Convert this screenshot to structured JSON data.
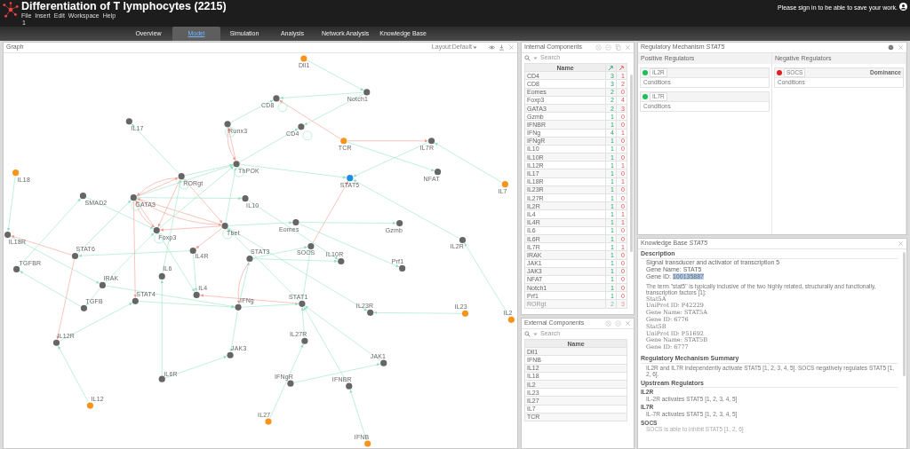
{
  "app": {
    "title": "Differentiation of T lymphocytes (2215)",
    "menu": [
      "File",
      "Insert",
      "Edit",
      "Workspace",
      "Help"
    ],
    "version": "1",
    "sign_in": "Please sign in to be able to save your work."
  },
  "tabs": [
    {
      "label": "Overview",
      "selected": false
    },
    {
      "label": "Model",
      "selected": true
    },
    {
      "label": "Simulation",
      "selected": false
    },
    {
      "label": "Analysis",
      "selected": false
    },
    {
      "label": "Network Analysis",
      "selected": false
    },
    {
      "label": "Knowledge Base",
      "selected": false
    }
  ],
  "graph": {
    "title": "Graph",
    "layout": "Layout:Default",
    "nodes": [
      {
        "label": "Dll1",
        "color": "#f7941d"
      },
      {
        "label": "Notch1",
        "color": "#666666"
      },
      {
        "label": "CD8",
        "color": "#666666"
      },
      {
        "label": "IL17",
        "color": "#666666"
      },
      {
        "label": "Runx3",
        "color": "#666666"
      },
      {
        "label": "CD4",
        "color": "#666666"
      },
      {
        "label": "TCR",
        "color": "#f7941d"
      },
      {
        "label": "IL7R",
        "color": "#666666"
      },
      {
        "label": "ThPOK",
        "color": "#666666"
      },
      {
        "label": "IL18",
        "color": "#f7941d"
      },
      {
        "label": "NFAT",
        "color": "#666666"
      },
      {
        "label": "RORgt",
        "color": "#666666"
      },
      {
        "label": "STAT5",
        "color": "#1a8fe3"
      },
      {
        "label": "IL7",
        "color": "#f7941d"
      },
      {
        "label": "SMAD2",
        "color": "#666666"
      },
      {
        "label": "GATA3",
        "color": "#666666"
      },
      {
        "label": "IL10",
        "color": "#666666"
      },
      {
        "label": "Eomes",
        "color": "#666666"
      },
      {
        "label": "Gzmb",
        "color": "#666666"
      },
      {
        "label": "Tbet",
        "color": "#666666"
      },
      {
        "label": "Foxp3",
        "color": "#666666"
      },
      {
        "label": "IL18R",
        "color": "#666666"
      },
      {
        "label": "IL2R",
        "color": "#666666"
      },
      {
        "label": "SOCS",
        "color": "#666666"
      },
      {
        "label": "STAT6",
        "color": "#666666"
      },
      {
        "label": "IL4R",
        "color": "#666666"
      },
      {
        "label": "STAT3",
        "color": "#666666"
      },
      {
        "label": "IL10R",
        "color": "#666666"
      },
      {
        "label": "Prf1",
        "color": "#666666"
      },
      {
        "label": "TGFBR",
        "color": "#666666"
      },
      {
        "label": "IL6",
        "color": "#666666"
      },
      {
        "label": "IRAK",
        "color": "#666666"
      },
      {
        "label": "IL4",
        "color": "#666666"
      },
      {
        "label": "STAT4",
        "color": "#666666"
      },
      {
        "label": "STAT1",
        "color": "#666666"
      },
      {
        "label": "IFNg",
        "color": "#666666"
      },
      {
        "label": "TGFB",
        "color": "#666666"
      },
      {
        "label": "IL23R",
        "color": "#666666"
      },
      {
        "label": "IL23",
        "color": "#f7941d"
      },
      {
        "label": "IL2",
        "color": "#f7941d"
      },
      {
        "label": "IL27R",
        "color": "#666666"
      },
      {
        "label": "IL12R",
        "color": "#666666"
      },
      {
        "label": "JAK3",
        "color": "#666666"
      },
      {
        "label": "JAK1",
        "color": "#666666"
      },
      {
        "label": "IL6R",
        "color": "#666666"
      },
      {
        "label": "IFNgR",
        "color": "#666666"
      },
      {
        "label": "IFNBR",
        "color": "#666666"
      },
      {
        "label": "IL12",
        "color": "#f7941d"
      },
      {
        "label": "IL27",
        "color": "#f7941d"
      },
      {
        "label": "IFNB",
        "color": "#f7941d"
      }
    ]
  },
  "internal_components": {
    "title": "Internal Components",
    "search": {
      "placeholder": "Search"
    },
    "columns": [
      "Name"
    ],
    "rows": [
      {
        "name": "CD4",
        "positive": "3",
        "negative": "1"
      },
      {
        "name": "CD8",
        "positive": "3",
        "negative": "2"
      },
      {
        "name": "Eomes",
        "positive": "2",
        "negative": "0"
      },
      {
        "name": "Foxp3",
        "positive": "2",
        "negative": "4"
      },
      {
        "name": "GATA3",
        "positive": "2",
        "negative": "3"
      },
      {
        "name": "Gzmb",
        "positive": "1",
        "negative": "0"
      },
      {
        "name": "IFNBR",
        "positive": "1",
        "negative": "0"
      },
      {
        "name": "IFNg",
        "positive": "4",
        "negative": "1"
      },
      {
        "name": "IFNgR",
        "positive": "1",
        "negative": "0"
      },
      {
        "name": "IL10",
        "positive": "1",
        "negative": "0"
      },
      {
        "name": "IL10R",
        "positive": "1",
        "negative": "0"
      },
      {
        "name": "IL12R",
        "positive": "1",
        "negative": "1"
      },
      {
        "name": "IL17",
        "positive": "1",
        "negative": "0"
      },
      {
        "name": "IL18R",
        "positive": "1",
        "negative": "1"
      },
      {
        "name": "IL23R",
        "positive": "1",
        "negative": "0"
      },
      {
        "name": "IL27R",
        "positive": "1",
        "negative": "0"
      },
      {
        "name": "IL2R",
        "positive": "1",
        "negative": "0"
      },
      {
        "name": "IL4",
        "positive": "1",
        "negative": "1"
      },
      {
        "name": "IL4R",
        "positive": "1",
        "negative": "1"
      },
      {
        "name": "IL6",
        "positive": "1",
        "negative": "0"
      },
      {
        "name": "IL6R",
        "positive": "1",
        "negative": "0"
      },
      {
        "name": "IL7R",
        "positive": "1",
        "negative": "1"
      },
      {
        "name": "IRAK",
        "positive": "1",
        "negative": "0"
      },
      {
        "name": "JAK1",
        "positive": "1",
        "negative": "0"
      },
      {
        "name": "JAK3",
        "positive": "1",
        "negative": "0"
      },
      {
        "name": "NFAT",
        "positive": "1",
        "negative": "0"
      },
      {
        "name": "Notch1",
        "positive": "1",
        "negative": "0"
      },
      {
        "name": "Prf1",
        "positive": "1",
        "negative": "0"
      },
      {
        "name": "RORgt",
        "positive": "2",
        "negative": "3"
      }
    ]
  },
  "external_components": {
    "title": "External Components",
    "search": {
      "placeholder": "Search"
    },
    "columns": [
      "Name"
    ],
    "rows": [
      "Dll1",
      "IFNB",
      "IL12",
      "IL18",
      "IL2",
      "IL23",
      "IL27",
      "IL7",
      "TCR"
    ]
  },
  "regulatory_mechanism": {
    "title": "Regulatory Mechanism *STAT5*",
    "columns": [
      {
        "title": "Positive Regulators",
        "regulators": [
          {
            "name": "IL2R",
            "color": "#1cbf5a",
            "conditions": "Conditions"
          },
          {
            "name": "IL7R",
            "color": "#1cbf5a",
            "conditions": "Conditions"
          }
        ]
      },
      {
        "title": "Negative Regulators",
        "dominance": "Dominance",
        "regulators": [
          {
            "name": "SOCS",
            "color": "#e02020",
            "conditions": "Conditions"
          }
        ]
      }
    ]
  },
  "knowledge_base": {
    "title": "Knowledge Base *STAT5*",
    "description": {
      "heading": "Description",
      "lines": [
        "Signal transducer and activator of transcription 5",
        "Gene Name: STAT5"
      ],
      "gene_id": {
        "label": "Gene ID:",
        "value": "100135887",
        "highlighted": true
      },
      "paragraph": "The term \"stat5\" is typically inclusive of the two highly related, structurally and functionally, transcription factors [1]:",
      "details": [
        "Stat5A",
        "UniProt ID: P42229",
        "Gene Name: STAT5A",
        "Gene ID: 6776",
        "Stat5B",
        "UniProt ID: P51692",
        "Gene Name: STAT5B",
        "Gene ID: 6777"
      ]
    },
    "summary": {
      "heading": "Regulatory Mechanism Summary",
      "text": "IL2R and IL7R independently activate STAT5 [1, 2, 3, 4, 5]. SOCS negatively regulates STAT5 [1, 2, 6]."
    },
    "upstream": {
      "heading": "Upstream Regulators",
      "items": [
        {
          "name": "IL2R",
          "text": "IL-2R activates STAT5 [1, 2, 3, 4, 5]"
        },
        {
          "name": "IL7R",
          "text": "IL-7R activates STAT5 [1, 2, 3, 4, 5]"
        },
        {
          "name": "SOCS",
          "text": "SOCS is able to inhibit STAT5 [1, 2, 6]"
        }
      ]
    }
  }
}
